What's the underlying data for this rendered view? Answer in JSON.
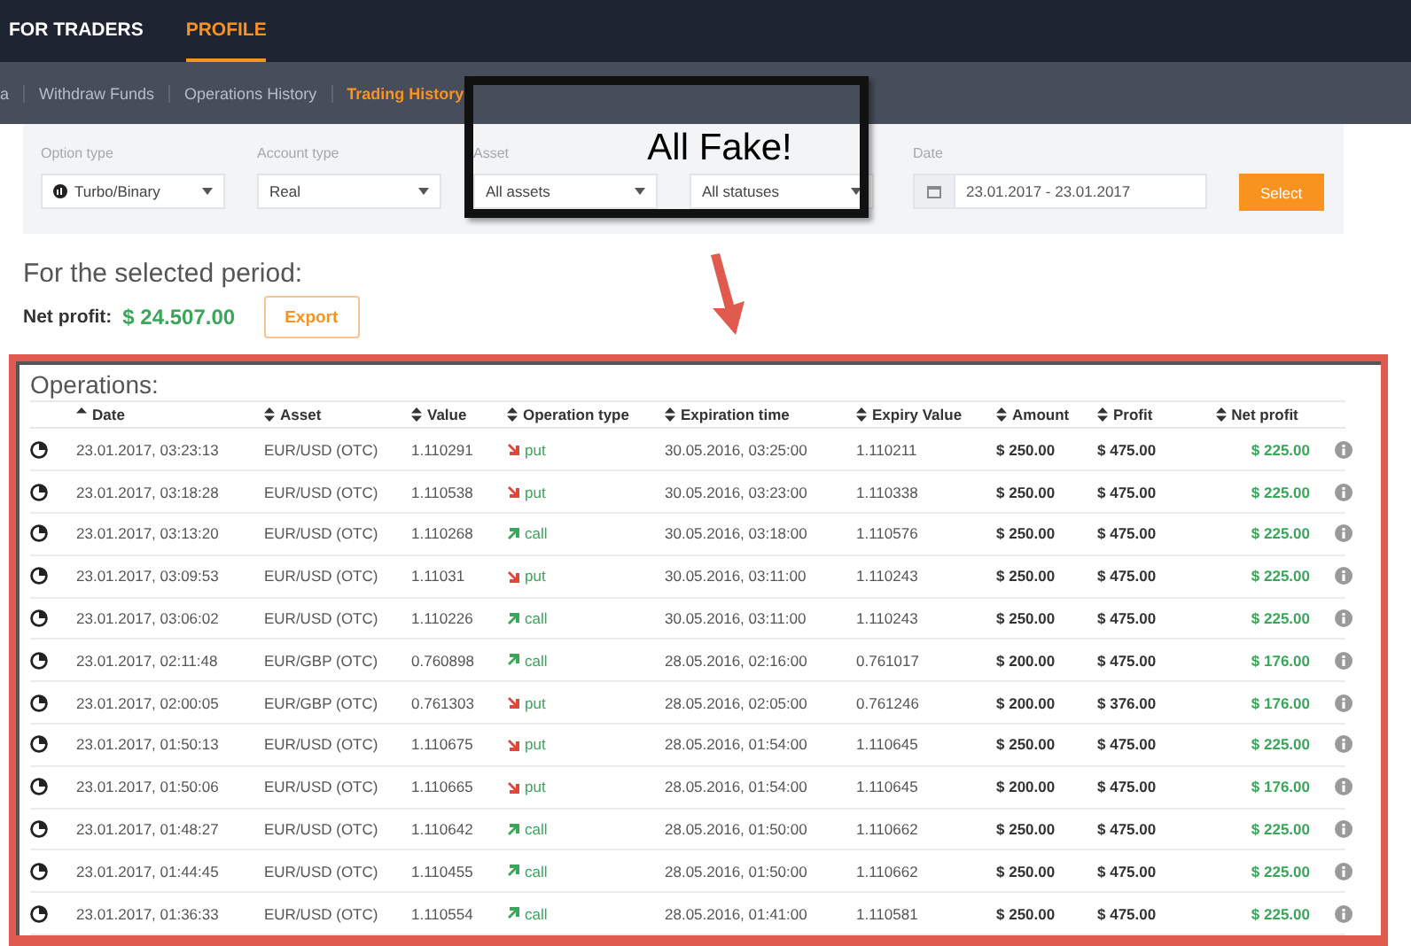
{
  "nav": {
    "items": [
      {
        "label": "FOR TRADERS",
        "selected": false
      },
      {
        "label": "PROFILE",
        "selected": true
      }
    ]
  },
  "subnav": {
    "items": [
      {
        "label": "a",
        "selected": false
      },
      {
        "label": "Withdraw Funds",
        "selected": false
      },
      {
        "label": "Operations History",
        "selected": false
      },
      {
        "label": "Trading History",
        "selected": true
      }
    ]
  },
  "filters": [
    {
      "kind": "type-select",
      "label": "Option type",
      "value": "Turbo/Binary"
    },
    {
      "kind": "select",
      "label": "Account type",
      "value": "Real"
    },
    {
      "kind": "select",
      "label": "Asset",
      "value": "All assets"
    },
    {
      "kind": "select",
      "value": "All statuses"
    },
    {
      "kind": "date",
      "label": "Date",
      "value": "23.01.2017 - 23.01.2017"
    }
  ],
  "select_button": "Select",
  "summary": {
    "heading": "For the selected period:",
    "net_profit_label": "Net profit:",
    "net_profit": "$ 24.507.00",
    "export_button": "Export"
  },
  "annotation": {
    "text": "All Fake!"
  },
  "operations": {
    "title": "Operations:",
    "columns": [
      {
        "label": "Date",
        "sorted": true
      },
      {
        "label": "Asset",
        "sorted": false
      },
      {
        "label": "Value",
        "sorted": false
      },
      {
        "label": "Operation type",
        "sorted": false
      },
      {
        "label": "Expiration time",
        "sorted": false
      },
      {
        "label": "Expiry Value",
        "sorted": false
      },
      {
        "label": "Amount",
        "sorted": false
      },
      {
        "label": "Profit",
        "sorted": false
      },
      {
        "label": "Net profit",
        "sorted": false
      }
    ],
    "rows": [
      {
        "date": "23.01.2017, 03:23:13",
        "asset": "EUR/USD (OTC)",
        "value": "1.110291",
        "kind": "put",
        "operation_type": "put",
        "expiration_time": "30.05.2016, 03:25:00",
        "expiry_value": "1.110211",
        "amount": "$ 250.00",
        "profit": "$ 475.00",
        "net_profit": "$ 225.00"
      },
      {
        "date": "23.01.2017, 03:18:28",
        "asset": "EUR/USD (OTC)",
        "value": "1.110538",
        "kind": "put",
        "operation_type": "put",
        "expiration_time": "30.05.2016, 03:23:00",
        "expiry_value": "1.110338",
        "amount": "$ 250.00",
        "profit": "$ 475.00",
        "net_profit": "$ 225.00"
      },
      {
        "date": "23.01.2017, 03:13:20",
        "asset": "EUR/USD (OTC)",
        "value": "1.110268",
        "kind": "call",
        "operation_type": "call",
        "expiration_time": "30.05.2016, 03:18:00",
        "expiry_value": "1.110576",
        "amount": "$ 250.00",
        "profit": "$ 475.00",
        "net_profit": "$ 225.00"
      },
      {
        "date": "23.01.2017, 03:09:53",
        "asset": "EUR/USD (OTC)",
        "value": "1.11031",
        "kind": "put",
        "operation_type": "put",
        "expiration_time": "30.05.2016, 03:11:00",
        "expiry_value": "1.110243",
        "amount": "$ 250.00",
        "profit": "$ 475.00",
        "net_profit": "$ 225.00"
      },
      {
        "date": "23.01.2017, 03:06:02",
        "asset": "EUR/USD (OTC)",
        "value": "1.110226",
        "kind": "call",
        "operation_type": "call",
        "expiration_time": "30.05.2016, 03:11:00",
        "expiry_value": "1.110243",
        "amount": "$ 250.00",
        "profit": "$ 475.00",
        "net_profit": "$ 225.00"
      },
      {
        "date": "23.01.2017, 02:11:48",
        "asset": "EUR/GBP (OTC)",
        "value": "0.760898",
        "kind": "call",
        "operation_type": "call",
        "expiration_time": "28.05.2016, 02:16:00",
        "expiry_value": "0.761017",
        "amount": "$ 200.00",
        "profit": "$ 475.00",
        "net_profit": "$ 176.00"
      },
      {
        "date": "23.01.2017, 02:00:05",
        "asset": "EUR/GBP (OTC)",
        "value": "0.761303",
        "kind": "put",
        "operation_type": "put",
        "expiration_time": "28.05.2016, 02:05:00",
        "expiry_value": "0.761246",
        "amount": "$ 200.00",
        "profit": "$ 376.00",
        "net_profit": "$ 176.00"
      },
      {
        "date": "23.01.2017, 01:50:13",
        "asset": "EUR/USD (OTC)",
        "value": "1.110675",
        "kind": "put",
        "operation_type": "put",
        "expiration_time": "28.05.2016, 01:54:00",
        "expiry_value": "1.110645",
        "amount": "$ 250.00",
        "profit": "$ 475.00",
        "net_profit": "$ 225.00"
      },
      {
        "date": "23.01.2017, 01:50:06",
        "asset": "EUR/USD (OTC)",
        "value": "1.110665",
        "kind": "put",
        "operation_type": "put",
        "expiration_time": "28.05.2016, 01:54:00",
        "expiry_value": "1.110645",
        "amount": "$ 200.00",
        "profit": "$ 475.00",
        "net_profit": "$ 176.00"
      },
      {
        "date": "23.01.2017, 01:48:27",
        "asset": "EUR/USD (OTC)",
        "value": "1.110642",
        "kind": "call",
        "operation_type": "call",
        "expiration_time": "28.05.2016, 01:50:00",
        "expiry_value": "1.110662",
        "amount": "$ 250.00",
        "profit": "$ 475.00",
        "net_profit": "$ 225.00"
      },
      {
        "date": "23.01.2017, 01:44:45",
        "asset": "EUR/USD (OTC)",
        "value": "1.110455",
        "kind": "call",
        "operation_type": "call",
        "expiration_time": "28.05.2016, 01:50:00",
        "expiry_value": "1.110662",
        "amount": "$ 250.00",
        "profit": "$ 475.00",
        "net_profit": "$ 225.00"
      },
      {
        "date": "23.01.2017, 01:36:33",
        "asset": "EUR/USD (OTC)",
        "value": "1.110554",
        "kind": "call",
        "operation_type": "call",
        "expiration_time": "28.05.2016, 01:41:00",
        "expiry_value": "1.110581",
        "amount": "$ 250.00",
        "profit": "$ 475.00",
        "net_profit": "$ 225.00"
      }
    ]
  }
}
